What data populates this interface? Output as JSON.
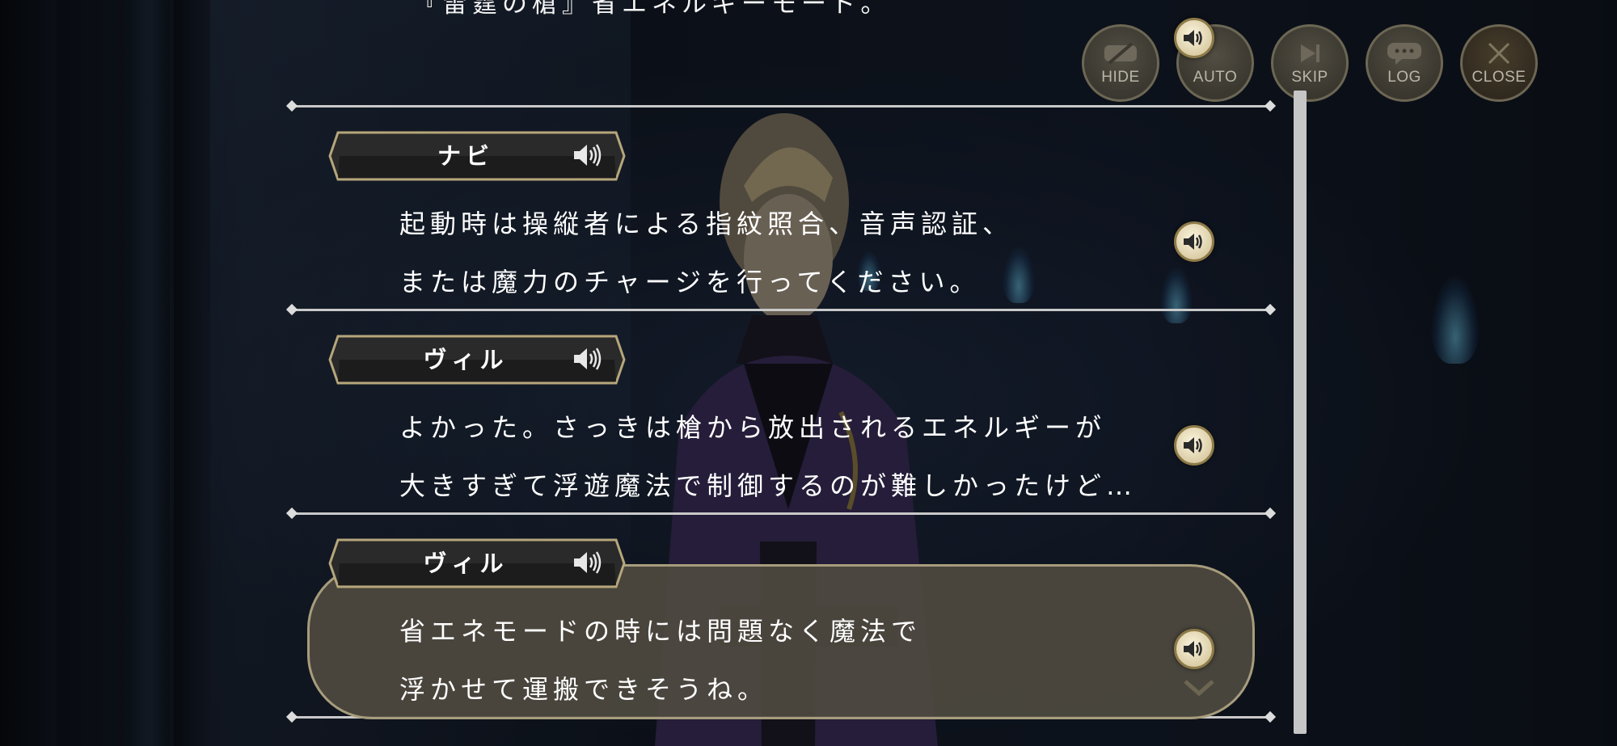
{
  "top_partial_line": "『雷霆の槍』省エネルギーモード。",
  "controls": [
    {
      "id": "hide",
      "label": "HIDE"
    },
    {
      "id": "auto",
      "label": "AUTO"
    },
    {
      "id": "skip",
      "label": "SKIP"
    },
    {
      "id": "log",
      "label": "LOG"
    },
    {
      "id": "close",
      "label": "CLOSE"
    }
  ],
  "log": {
    "entries": [
      {
        "speaker": "ナビ",
        "lines": [
          "起動時は操縦者による指紋照合、音声認証、",
          "または魔力のチャージを行ってください。"
        ]
      },
      {
        "speaker": "ヴィル",
        "lines": [
          "よかった。さっきは槍から放出されるエネルギーが",
          "大きすぎて浮遊魔法で制御するのが難しかったけど…"
        ]
      },
      {
        "speaker": "ヴィル",
        "lines": [
          "省エネモードの時には問題なく魔法で",
          "浮かせて運搬できそうね。"
        ]
      }
    ]
  },
  "icons": {
    "voice_replay": "speaker-icon",
    "nameplate_voice": "speaker-icon",
    "latest_indicator": "chevron-down-icon"
  },
  "colors": {
    "gold_border": "#a79c7c",
    "button_fill": "#4a4537",
    "divider": "#c9c9c9"
  }
}
